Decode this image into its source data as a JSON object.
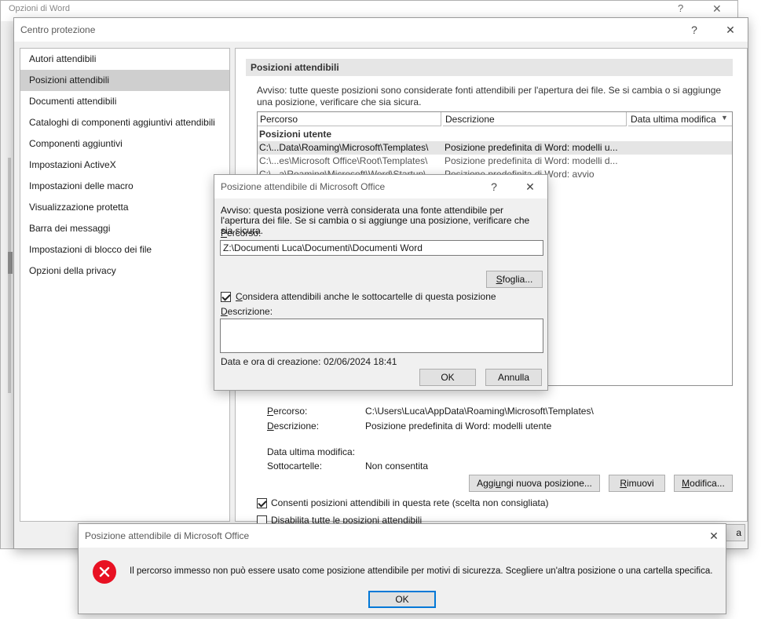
{
  "word_options": {
    "title": "Opzioni di Word"
  },
  "trust_center": {
    "title": "Centro protezione",
    "help": "?",
    "close": "✕",
    "nav": [
      {
        "label": "Autori attendibili"
      },
      {
        "label": "Posizioni attendibili",
        "selected": true
      },
      {
        "label": "Documenti attendibili"
      },
      {
        "label": "Cataloghi di componenti aggiuntivi attendibili"
      },
      {
        "label": "Componenti aggiuntivi"
      },
      {
        "label": "Impostazioni ActiveX"
      },
      {
        "label": "Impostazioni delle macro"
      },
      {
        "label": "Visualizzazione protetta"
      },
      {
        "label": "Barra dei messaggi"
      },
      {
        "label": "Impostazioni di blocco dei file"
      },
      {
        "label": "Opzioni della privacy"
      }
    ],
    "section_header": "Posizioni attendibili",
    "warning": "Avviso: tutte queste posizioni sono considerate fonti attendibili per l'apertura dei file. Se si cambia o si aggiunge una posizione, verificare che sia sicura.",
    "table": {
      "columns": [
        "Percorso",
        "Descrizione",
        "Data ultima modifica"
      ],
      "group": "Posizioni utente",
      "rows": [
        {
          "path": "C:\\...Data\\Roaming\\Microsoft\\Templates\\",
          "desc": "Posizione predefinita di Word: modelli u...",
          "selected": true
        },
        {
          "path": "C:\\...es\\Microsoft Office\\Root\\Templates\\",
          "desc": "Posizione predefinita di Word: modelli d..."
        },
        {
          "path": "C:\\...a\\Roaming\\Microsoft\\Word\\Startup\\",
          "desc": "Posizione predefinita di Word: avvio"
        }
      ]
    },
    "details": {
      "path_label": "Percorso:",
      "path_value": "C:\\Users\\Luca\\AppData\\Roaming\\Microsoft\\Templates\\",
      "desc_label": "Descrizione:",
      "desc_value": "Posizione predefinita di Word: modelli utente",
      "modified_label": "Data ultima modifica:",
      "subfolders_label": "Sottocartelle:",
      "subfolders_value": "Non consentita"
    },
    "buttons": {
      "add": "Aggiungi nuova posizione...",
      "remove": "Rimuovi",
      "modify": "Modifica..."
    },
    "checkboxes": [
      {
        "label": "Consenti posizioni attendibili in questa rete (scelta non consigliata)",
        "checked": true
      },
      {
        "label": "Disabilita tutte le posizioni attendibili",
        "checked": false
      }
    ],
    "footer_partial": "a"
  },
  "location_dialog": {
    "title": "Posizione attendibile di Microsoft Office",
    "help": "?",
    "close": "✕",
    "warning": "Avviso: questa posizione verrà considerata una fonte attendibile per l'apertura dei file. Se si cambia o si aggiunge una posizione, verificare che sia sicura.",
    "path_label": "Percorso:",
    "path_value": "Z:\\Documenti Luca\\Documenti\\Documenti Word",
    "browse": "Sfoglia...",
    "subfolders_label": "Considera attendibili anche le sottocartelle di questa posizione",
    "subfolders_checked": true,
    "desc_label": "Descrizione:",
    "desc_value": "",
    "created_label": "Data e ora di creazione:",
    "created_value": "02/06/2024 18:41",
    "ok": "OK",
    "cancel": "Annulla"
  },
  "error_dialog": {
    "title": "Posizione attendibile di Microsoft Office",
    "close": "✕",
    "message": "Il percorso immesso non può essere usato come posizione attendibile per motivi di sicurezza. Scegliere un'altra posizione o una cartella specifica.",
    "ok": "OK",
    "icon": "error-icon",
    "icon_color": "#e81123"
  }
}
